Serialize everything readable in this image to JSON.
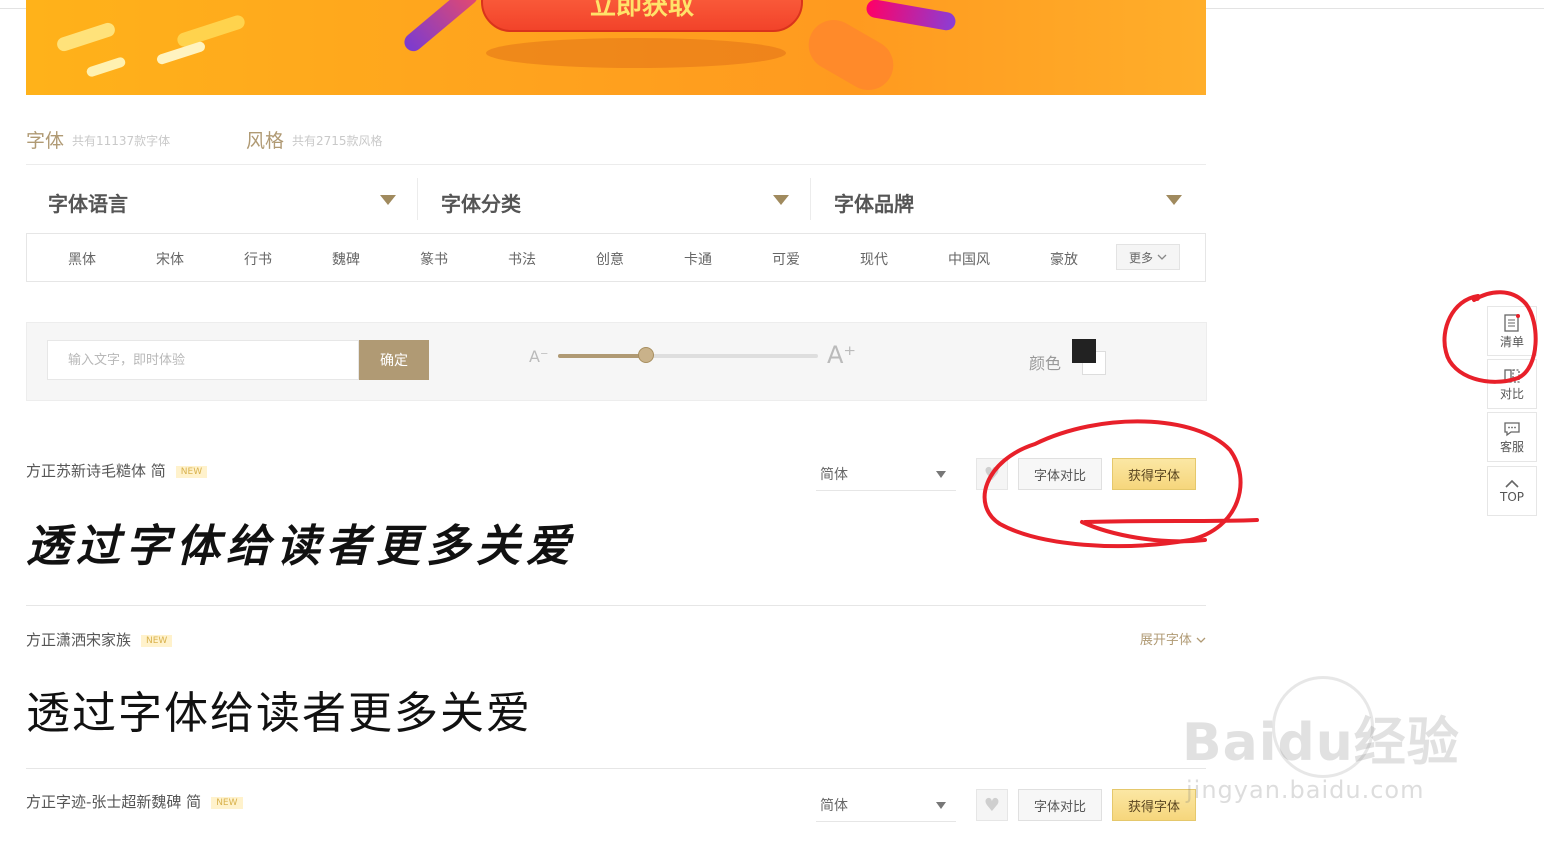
{
  "banner": {
    "button_label": "立即获取"
  },
  "category_header": {
    "fonts_label": "字体",
    "fonts_count": "共有11137款字体",
    "styles_label": "风格",
    "styles_count": "共有2715款风格"
  },
  "filters": [
    {
      "label": "字体语言"
    },
    {
      "label": "字体分类"
    },
    {
      "label": "字体品牌"
    }
  ],
  "tags": [
    "黑体",
    "宋体",
    "行书",
    "魏碑",
    "篆书",
    "书法",
    "创意",
    "卡通",
    "可爱",
    "现代",
    "中国风",
    "豪放"
  ],
  "more_label": "更多",
  "toolbar": {
    "input_placeholder": "输入文字，即时体验",
    "confirm_label": "确定",
    "size_min_label": "A⁻",
    "size_max_label": "A⁺",
    "size_level": 0.34,
    "color_label": "颜色",
    "fg_color": "#222222",
    "bg_color": "#ffffff"
  },
  "fonts": [
    {
      "name": "方正苏新诗毛糙体 简",
      "badge": "NEW",
      "sample": "透过字体给读者更多关爱",
      "variant": "简体",
      "compare_label": "字体对比",
      "get_label": "获得字体"
    },
    {
      "name": "方正潇洒宋家族",
      "badge": "NEW",
      "sample": "透过字体给读者更多关爱",
      "expand_label": "展开字体"
    },
    {
      "name": "方正字迹-张士超新魏碑 简",
      "badge": "NEW",
      "variant": "简体",
      "compare_label": "字体对比",
      "get_label": "获得字体"
    }
  ],
  "sidebar": {
    "list_label": "清单",
    "compare_label": "对比",
    "service_label": "客服",
    "top_label": "TOP"
  },
  "watermark": {
    "brand": "Baidu经验",
    "url": "jingyan.baidu.com"
  },
  "colors": {
    "accent": "#b09a74",
    "annotation": "#e8202a",
    "banner_orange": "#ffa21e"
  }
}
